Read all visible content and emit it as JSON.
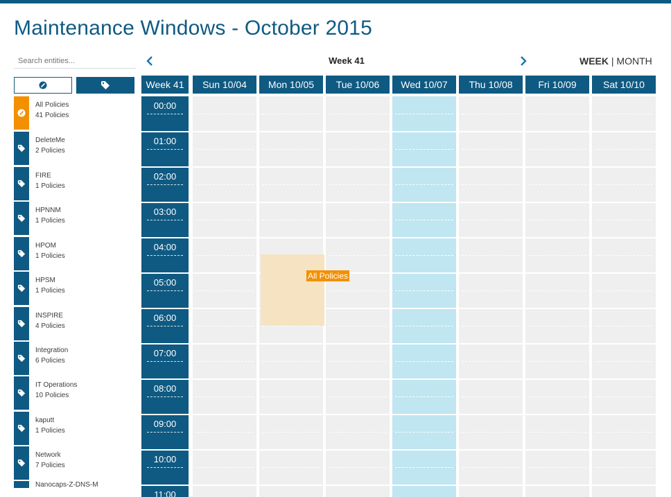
{
  "page": {
    "title": "Maintenance Windows - October 2015"
  },
  "search": {
    "placeholder": "Search entities..."
  },
  "calendar": {
    "week_title": "Week 41",
    "prev_icon": "chevron-left-icon",
    "next_icon": "chevron-right-icon",
    "view_week": "WEEK",
    "view_separator": "|",
    "view_month": "MONTH",
    "header_week": "Week 41",
    "days": [
      "Sun 10/04",
      "Mon 10/05",
      "Tue 10/06",
      "Wed 10/07",
      "Thu 10/08",
      "Fri 10/09",
      "Sat 10/10"
    ],
    "today_index": 3,
    "hours": [
      "00:00",
      "01:00",
      "02:00",
      "03:00",
      "04:00",
      "05:00",
      "06:00",
      "07:00",
      "08:00",
      "09:00",
      "10:00",
      "11:00"
    ]
  },
  "filter_tabs": [
    {
      "icon": "policy-icon",
      "active": false
    },
    {
      "icon": "tag-icon",
      "active": true
    }
  ],
  "sidebar": {
    "items": [
      {
        "name": "All Policies",
        "count": "41 Policies",
        "icon": "policy-icon",
        "active": true
      },
      {
        "name": "DeleteMe",
        "count": "2 Policies",
        "icon": "tag-icon"
      },
      {
        "name": "FIRE",
        "count": "1 Policies",
        "icon": "tag-icon"
      },
      {
        "name": "HPNNM",
        "count": "1 Policies",
        "icon": "tag-icon"
      },
      {
        "name": "HPOM",
        "count": "1 Policies",
        "icon": "tag-icon"
      },
      {
        "name": "HPSM",
        "count": "1 Policies",
        "icon": "tag-icon"
      },
      {
        "name": "INSPIRE",
        "count": "4 Policies",
        "icon": "tag-icon"
      },
      {
        "name": "Integration",
        "count": "6 Policies",
        "icon": "tag-icon"
      },
      {
        "name": "IT Operations",
        "count": "10 Policies",
        "icon": "tag-icon"
      },
      {
        "name": "kaputt",
        "count": "1 Policies",
        "icon": "tag-icon"
      },
      {
        "name": "Network",
        "count": "7 Policies",
        "icon": "tag-icon"
      },
      {
        "name": "Nanocaps-Z-DNS-M",
        "count": "",
        "icon": "tag-icon"
      }
    ]
  },
  "event": {
    "label": "All Policies",
    "day": "Mon 10/05",
    "start": "04:30",
    "end": "06:30"
  },
  "colors": {
    "brand": "#0f5a82",
    "accent": "#f39000",
    "today": "#bfe6f1",
    "event_bg": "#f5e3c1",
    "grid": "#efefef"
  }
}
